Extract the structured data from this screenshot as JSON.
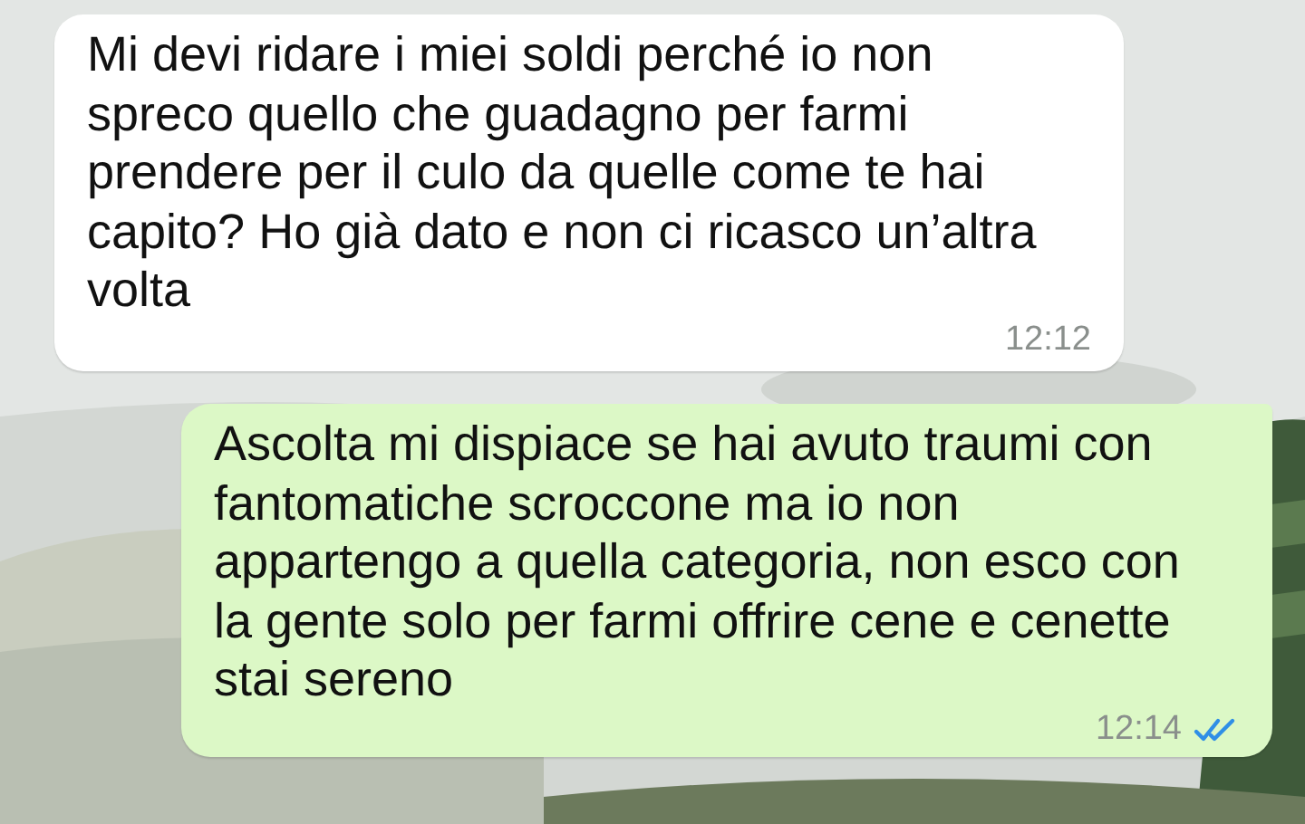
{
  "messages": [
    {
      "kind": "incoming",
      "text": "Mi devi ridare i miei soldi perché io non spreco quello che guadagno per farmi prendere per il culo da quelle come te hai capito? Ho già dato e non ci ricasco un’altra volta",
      "time": "12:12"
    },
    {
      "kind": "outgoing",
      "text": "Ascolta mi dispiace se hai avuto traumi con fantomatiche scroccone ma io non appartengo a quella categoria, non esco con la gente solo per farmi offrire cene e cenette stai sereno",
      "time": "12:14",
      "read": true
    }
  ]
}
